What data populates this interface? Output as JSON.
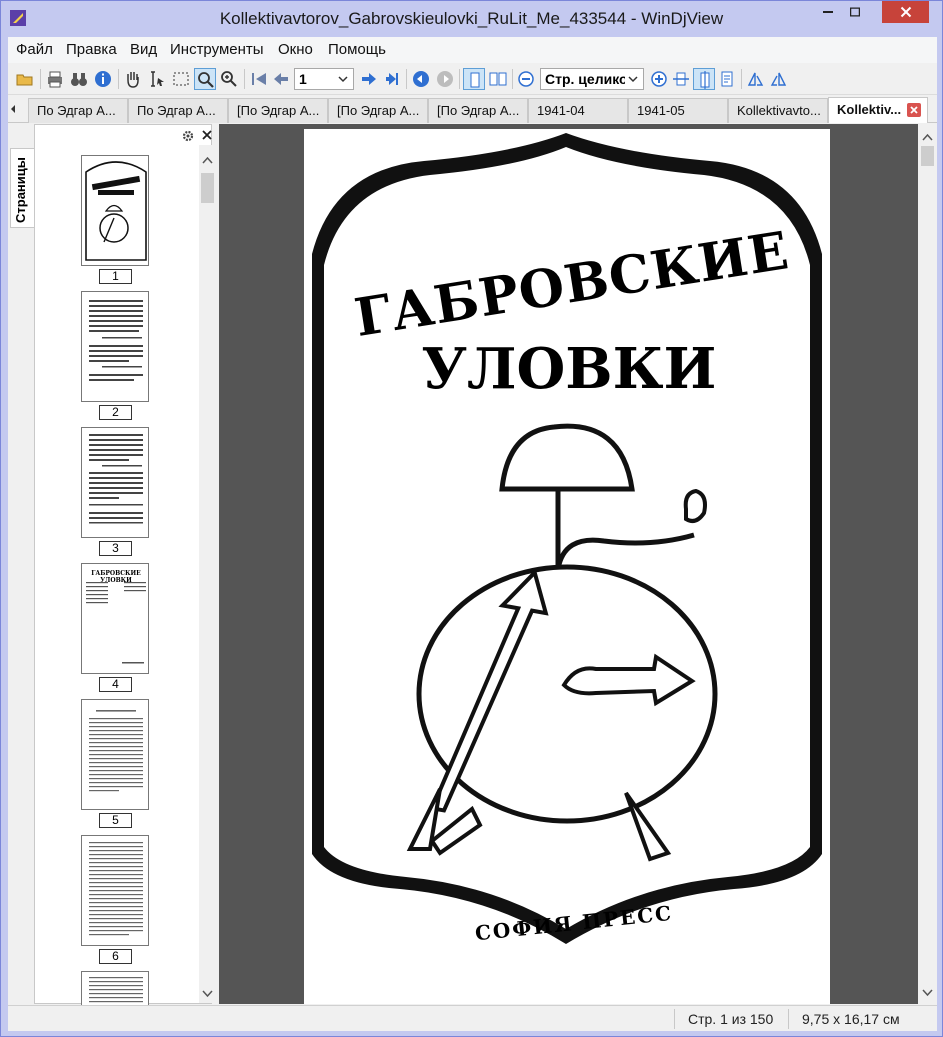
{
  "window": {
    "title": "Kollektivavtorov_Gabrovskieulovki_RuLit_Me_433544 - WinDjView"
  },
  "menu": [
    "Файл",
    "Правка",
    "Вид",
    "Инструменты",
    "Окно",
    "Помощь"
  ],
  "toolbar": {
    "page_number": "1",
    "zoom_mode": "Стр. целиком"
  },
  "tabs": [
    {
      "label": "По Эдгар А...",
      "active": false
    },
    {
      "label": "По Эдгар А...",
      "active": false
    },
    {
      "label": "[По Эдгар А...",
      "active": false
    },
    {
      "label": "[По Эдгар А...",
      "active": false
    },
    {
      "label": "[По Эдгар А...",
      "active": false
    },
    {
      "label": "1941-04",
      "active": false
    },
    {
      "label": "1941-05",
      "active": false
    },
    {
      "label": "Kollektivavto...",
      "active": false
    },
    {
      "label": "Kollektiv...",
      "active": true
    }
  ],
  "sidebar": {
    "tab_label": "Страницы",
    "thumbnails": [
      "1",
      "2",
      "3",
      "4",
      "5",
      "6"
    ],
    "thumb3_title": "ГАБРОВСКИЕ УЛОВКИ"
  },
  "document": {
    "cover_title_1": "ГАБРОВСКИЕ",
    "cover_title_2": "УЛОВКИ",
    "publisher": "СОФИЯ ПРЕСС"
  },
  "status": {
    "page_info": "Стр. 1 из 150",
    "page_size": "9,75 x 16,17 см"
  },
  "colors": {
    "title_bg": "#c4c9f0",
    "close_btn": "#c7433a",
    "viewer_bg": "#555555"
  }
}
